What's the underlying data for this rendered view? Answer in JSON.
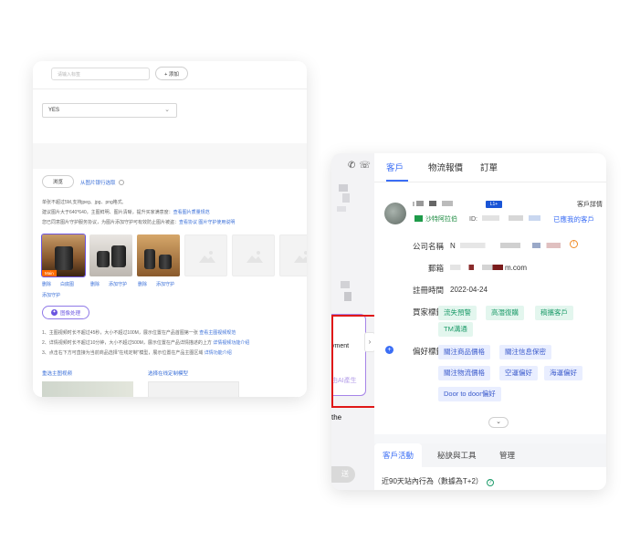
{
  "left_panel": {
    "tag_input_placeholder": "请输入标签",
    "add_button": "+ 添加",
    "yes_select_value": "YES",
    "browse_button": "浏览",
    "library_link": "从图片银行选取",
    "help_lines": [
      "单张不超过5M,支持jpeg、jpg、png格式,",
      "建议图片大于640*640，主图鲜明、图片清晰，提升买家满意度：",
      "您已同意图片守护服务协议，为图片添加守护可有效防止图片被盗："
    ],
    "help_links": {
      "quality_guide": "查看图片质量规范",
      "agreement": "查看协议",
      "guard_help": "图片守护使用说明"
    },
    "main_badge": "Main",
    "thumb_links": [
      "删除",
      "白底图",
      "删除",
      "添加守护",
      "删除",
      "添加守护",
      "添加守护"
    ],
    "image_process_button": "图像处理",
    "notes": [
      "1、主图视频时长不超过45秒，大小不超过100M，展示位置在产品首图第一张",
      "2、详情视频时长不超过10分钟，大小不超过500M，展示位置在产品详情描述的上方",
      "3、点击右下方可直接为当前商品选择\"在线定制\"模型，展示位置在产品主图区域"
    ],
    "note_links": [
      "查看主图视频规范",
      "详情视频功能介绍",
      "详情功能介绍"
    ],
    "video_left_label": "重选主图视频",
    "video_right_label": "选择在线定制模型"
  },
  "right_panel": {
    "header_icons": [
      "📞",
      "☏"
    ],
    "payment_text": "yment",
    "ai_text": "由AI產生",
    "the_text": "the",
    "send_text": "送",
    "collapse_arrow": "›",
    "tabs": [
      {
        "label": "客戶",
        "active": true
      },
      {
        "label": "物流報價",
        "active": false
      },
      {
        "label": "訂單",
        "active": false
      }
    ],
    "customer": {
      "name": "I",
      "level_badge": "L1+",
      "detail_link": "客戶詳情",
      "country": "沙特阿拉伯",
      "id_label": "ID:",
      "visited_link": "已應我的客戶"
    },
    "fields": [
      {
        "label": "公司名稱",
        "value": "N"
      },
      {
        "label": "郵箱",
        "value": "m.com"
      },
      {
        "label": "註冊時間",
        "value": "2022-04-24"
      },
      {
        "label": "買家標籤",
        "value": ""
      },
      {
        "label": "偏好標籤",
        "value": ""
      }
    ],
    "buyer_tags": [
      "流失預警",
      "高潛復購",
      "稿攜客戶",
      "TM溝通"
    ],
    "pref_tags": [
      "關注商品價格",
      "關注信息保密",
      "關注物流價格",
      "空運偏好",
      "海運偏好",
      "Door to door偏好"
    ],
    "expand_icon": "⌄",
    "bottom_tabs": [
      {
        "label": "客戶活動",
        "active": true
      },
      {
        "label": "秘訣與工具",
        "active": false
      },
      {
        "label": "管理",
        "active": false
      }
    ],
    "activity_text": "近90天站內行為（數據為T+2）",
    "accent_color": "#3b6ef5",
    "highlight_color": "#e01818"
  }
}
